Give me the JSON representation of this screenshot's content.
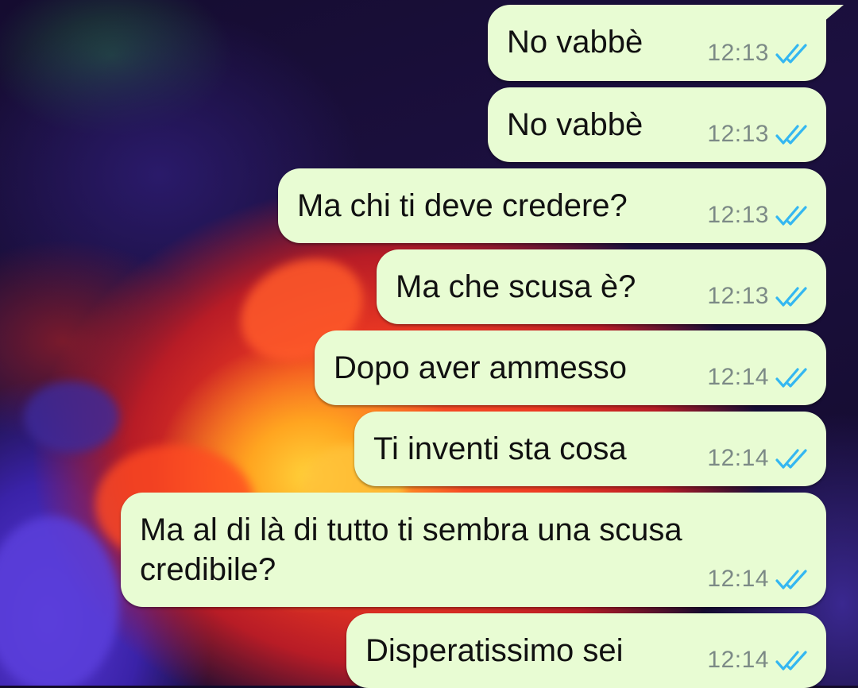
{
  "messages": [
    {
      "text": "No vabbè",
      "time": "12:13",
      "status": "read"
    },
    {
      "text": "No vabbè",
      "time": "12:13",
      "status": "read"
    },
    {
      "text": "Ma chi ti deve credere?",
      "time": "12:13",
      "status": "read"
    },
    {
      "text": "Ma che scusa è?",
      "time": "12:13",
      "status": "read"
    },
    {
      "text": "Dopo aver ammesso",
      "time": "12:14",
      "status": "read"
    },
    {
      "text": "Ti inventi sta cosa",
      "time": "12:14",
      "status": "read"
    },
    {
      "text": "Ma al di là di tutto ti sembra una scusa\ncredibile?",
      "time": "12:14",
      "status": "read"
    },
    {
      "text": "Disperatissimo sei",
      "time": "12:14",
      "status": "read"
    }
  ],
  "colors": {
    "bubble_outgoing": "#e8fcd3",
    "tick_read": "#34b7f1",
    "time_text": "#7c8a86"
  },
  "icons": {
    "read_status": "double-check-icon"
  }
}
